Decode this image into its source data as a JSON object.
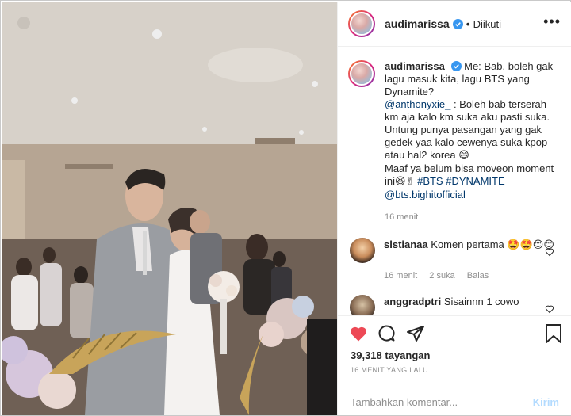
{
  "post": {
    "username": "audimarissa",
    "follow_status": "Diikuti",
    "more_icon": "more-horizontal-icon",
    "verified_icon": "verified-badge-icon"
  },
  "caption": {
    "username": "audimarissa",
    "line1": "Me: Bab, boleh gak lagu masuk kita, lagu BTS yang Dynamite?",
    "mention": "@anthonyxie_",
    "line2": ": Boleh bab terserah km aja kalo km suka aku pasti suka.",
    "line3": "Untung punya pasangan yang gak gedek yaa kalo cewenya suka kpop atau hal2 korea",
    "emoji1": "😄",
    "line4": "Maaf ya belum bisa moveon moment ini",
    "emoji2": "😆✌",
    "hashtag1": "#BTS",
    "hashtag2": "#DYNAMITE",
    "mention2": "@bts.bighitofficial",
    "time": "16 menit"
  },
  "comments": [
    {
      "username": "slstianaa",
      "text": "Komen pertama",
      "emoji": "🤩🤩😊😊",
      "time": "16 menit",
      "likes": "2 suka",
      "reply": "Balas"
    },
    {
      "username": "anggradptri",
      "text": "Sisainnn 1 cowo"
    }
  ],
  "actions": {
    "like_icon": "heart-filled-icon",
    "comment_icon": "comment-icon",
    "share_icon": "paper-plane-icon",
    "save_icon": "bookmark-icon",
    "views": "39,318 tayangan",
    "posted": "16 MENIT YANG LALU"
  },
  "composer": {
    "placeholder": "Tambahkan komentar...",
    "post_label": "Kirim"
  },
  "colors": {
    "like_red": "#ed4956",
    "link_blue": "#00376b",
    "verified_blue": "#3897f0",
    "muted_gray": "#8e8e8e",
    "post_disabled": "#b3dbff"
  }
}
